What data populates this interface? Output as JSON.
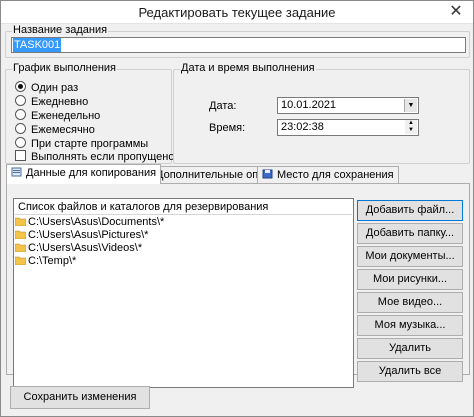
{
  "window": {
    "title": "Редактировать текущее задание",
    "close_glyph": "✕"
  },
  "task": {
    "group_label": "Название задания",
    "name_value": "TASK001"
  },
  "schedule": {
    "group_label": "График выполнения",
    "options": [
      {
        "label": "Один раз",
        "selected": true
      },
      {
        "label": "Ежедневно",
        "selected": false
      },
      {
        "label": "Еженедельно",
        "selected": false
      },
      {
        "label": "Ежемесячно",
        "selected": false
      },
      {
        "label": "При старте программы",
        "selected": false
      }
    ],
    "run_if_missed_label": "Выполнять если пропущено",
    "run_if_missed_checked": false
  },
  "datetime": {
    "group_label": "Дата и время выполнения",
    "date_label": "Дата:",
    "date_value": "10.01.2021",
    "time_label": "Время:",
    "time_value": "23:02:38"
  },
  "tabs": [
    {
      "label": "Данные для копирования",
      "active": true,
      "icon": "data-icon"
    },
    {
      "label": "Дополнительные опции",
      "active": false,
      "icon": "options-icon"
    },
    {
      "label": "Место для сохранения",
      "active": false,
      "icon": "save-location-icon"
    }
  ],
  "files": {
    "header": "Список файлов и каталогов для резервирования",
    "items": [
      "C:\\Users\\Asus\\Documents\\*",
      "C:\\Users\\Asus\\Pictures\\*",
      "C:\\Users\\Asus\\Videos\\*",
      "C:\\Temp\\*"
    ]
  },
  "buttons": {
    "add_file": "Добавить файл...",
    "add_folder": "Добавить папку...",
    "my_documents": "Мои документы...",
    "my_pictures": "Мои рисунки...",
    "my_videos": "Мое видео...",
    "my_music": "Моя музыка...",
    "remove": "Удалить",
    "remove_all": "Удалить все",
    "save": "Сохранить изменения"
  },
  "colors": {
    "selection": "#3399ff",
    "focus_border": "#0078d7",
    "folder": "#f3c34a"
  }
}
